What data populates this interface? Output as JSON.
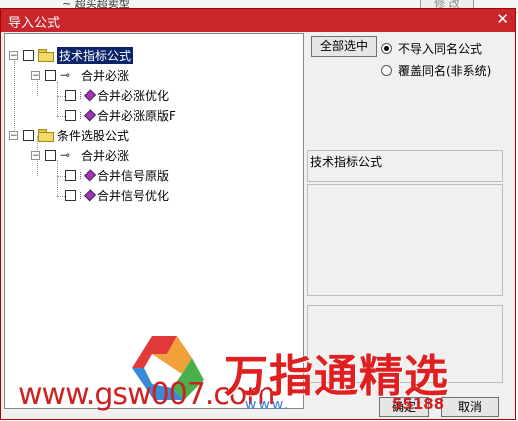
{
  "background": {
    "partial_text": "~ 超买超卖型",
    "button_text": "修 改"
  },
  "dialog": {
    "title": "导入公式",
    "close_glyph": "✕"
  },
  "tree": {
    "items": [
      {
        "label": "技术指标公式",
        "kind": "folder",
        "expander": "−",
        "selected": true
      },
      {
        "label": "合并必涨",
        "kind": "key",
        "expander": "−"
      },
      {
        "label": "合并必涨优化",
        "kind": "formula"
      },
      {
        "label": "合并必涨原版F",
        "kind": "formula"
      },
      {
        "label": "条件选股公式",
        "kind": "folder",
        "expander": "−"
      },
      {
        "label": "合并必涨",
        "kind": "key",
        "expander": "−"
      },
      {
        "label": "合并信号原版",
        "kind": "formula"
      },
      {
        "label": "合并信号优化",
        "kind": "formula"
      }
    ]
  },
  "options": {
    "select_all": "全部选中",
    "radio_no_import": "不导入同名公式",
    "radio_overwrite": "覆盖同名(非系统)",
    "selected_radio": "no_import"
  },
  "description": {
    "title": "技术指标公式"
  },
  "footer": {
    "ok": "确定",
    "cancel": "取消"
  },
  "watermark": {
    "left": "www.gsw007.com",
    "right": "万指通精选",
    "url_blue": "www.",
    "url_red": "55188"
  },
  "colors": {
    "titlebar": "#c8262a",
    "selection": "#0a246a",
    "watermark_red": "#e02020",
    "watermark_blue": "#3b7bd0"
  }
}
